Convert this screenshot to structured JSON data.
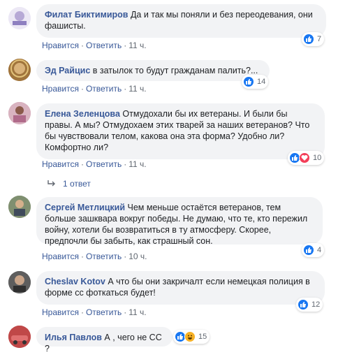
{
  "comments": [
    {
      "author": "Филат Биктимиров",
      "text": "Да и так мы поняли и без переодевания, они фашисты.",
      "reaction_count": "7",
      "like_label": "Нравится",
      "reply_label": "Ответить",
      "time": "11 ч."
    },
    {
      "author": "Эд Райцис",
      "text": "в затылок то будут гражданам палить?...",
      "reaction_count": "14",
      "like_label": "Нравится",
      "reply_label": "Ответить",
      "time": "11 ч."
    },
    {
      "author": "Елена Зеленцова",
      "text": "Отмудохали бы их ветераны. И были бы правы. А мы? Отмудохаем этих тварей за наших ветеранов? Что бы чувствовали телом, какова она эта форма? Удобно ли? Комфортно ли?",
      "reaction_count": "10",
      "like_label": "Нравится",
      "reply_label": "Ответить",
      "time": "11 ч.",
      "replies_label": "1 ответ"
    },
    {
      "author": "Сергей Метлицкий",
      "text": "Чем меньше остаётся ветеранов, тем больше зашквара вокруг победы. Не думаю, что те, кто пережил войну, хотели бы возвратиться в ту атмосферу. Скорее, предпочли бы забыть, как страшный сон.",
      "reaction_count": "4",
      "like_label": "Нравится",
      "reply_label": "Ответить",
      "time": "10 ч."
    },
    {
      "author": "Cheslav Kotov",
      "text": "А что бы они закричалт если немецкая полиция в форме сс фоткаться будет!",
      "reaction_count": "12",
      "like_label": "Нравится",
      "reply_label": "Ответить",
      "time": "11 ч."
    },
    {
      "author": "Илья Павлов",
      "text": "А , чего не СС ?",
      "reaction_count": "15"
    }
  ],
  "separator": "·",
  "colors": {
    "author": "#385898",
    "bubble": "#f2f3f5",
    "meta": "#606770",
    "like": "#1877f2",
    "love": "#f33e58",
    "haha": "#f7b125"
  }
}
